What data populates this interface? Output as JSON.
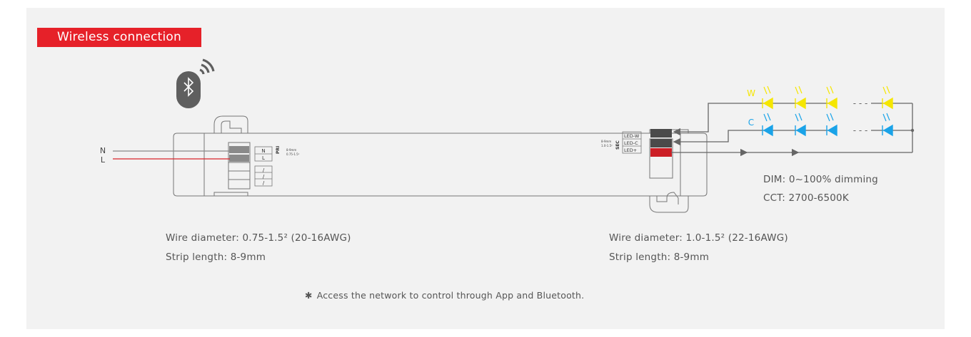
{
  "header": {
    "tag_label": "Wireless connection"
  },
  "colors": {
    "accent": "#e62129",
    "warm_led": "#f5e600",
    "cool_led": "#1aa3e8",
    "panel_bg": "#f2f2f2"
  },
  "input": {
    "neutral_label": "N",
    "live_label": "L"
  },
  "primary_block": {
    "side_label": "PRI",
    "n_label": "N",
    "l_label": "L",
    "slot_label": "/",
    "strip_note_1": "8-9mm",
    "strip_note_2": "0.75-1.5²"
  },
  "secondary_block": {
    "side_label": "SEC",
    "terminals": [
      "LED-W",
      "LED-C",
      "LED+"
    ],
    "strip_note_1": "8-9mm",
    "strip_note_2": "1.0-1.5²"
  },
  "leds": {
    "warm_label": "W",
    "cool_label": "C",
    "dash": "- - -"
  },
  "specs": {
    "dim": "DIM: 0~100% dimming",
    "cct": "CCT: 2700-6500K"
  },
  "left_info": {
    "wire": "Wire diameter: 0.75-1.5² (20-16AWG)",
    "strip": "Strip length: 8-9mm"
  },
  "right_info": {
    "wire": "Wire diameter: 1.0-1.5² (22-16AWG)",
    "strip": "Strip length: 8-9mm"
  },
  "footnote": {
    "star": "✱",
    "text": "Access the network to control through App and Bluetooth."
  },
  "icons": {
    "bluetooth": "bluetooth-icon",
    "signal": "wifi-signal-icon"
  }
}
